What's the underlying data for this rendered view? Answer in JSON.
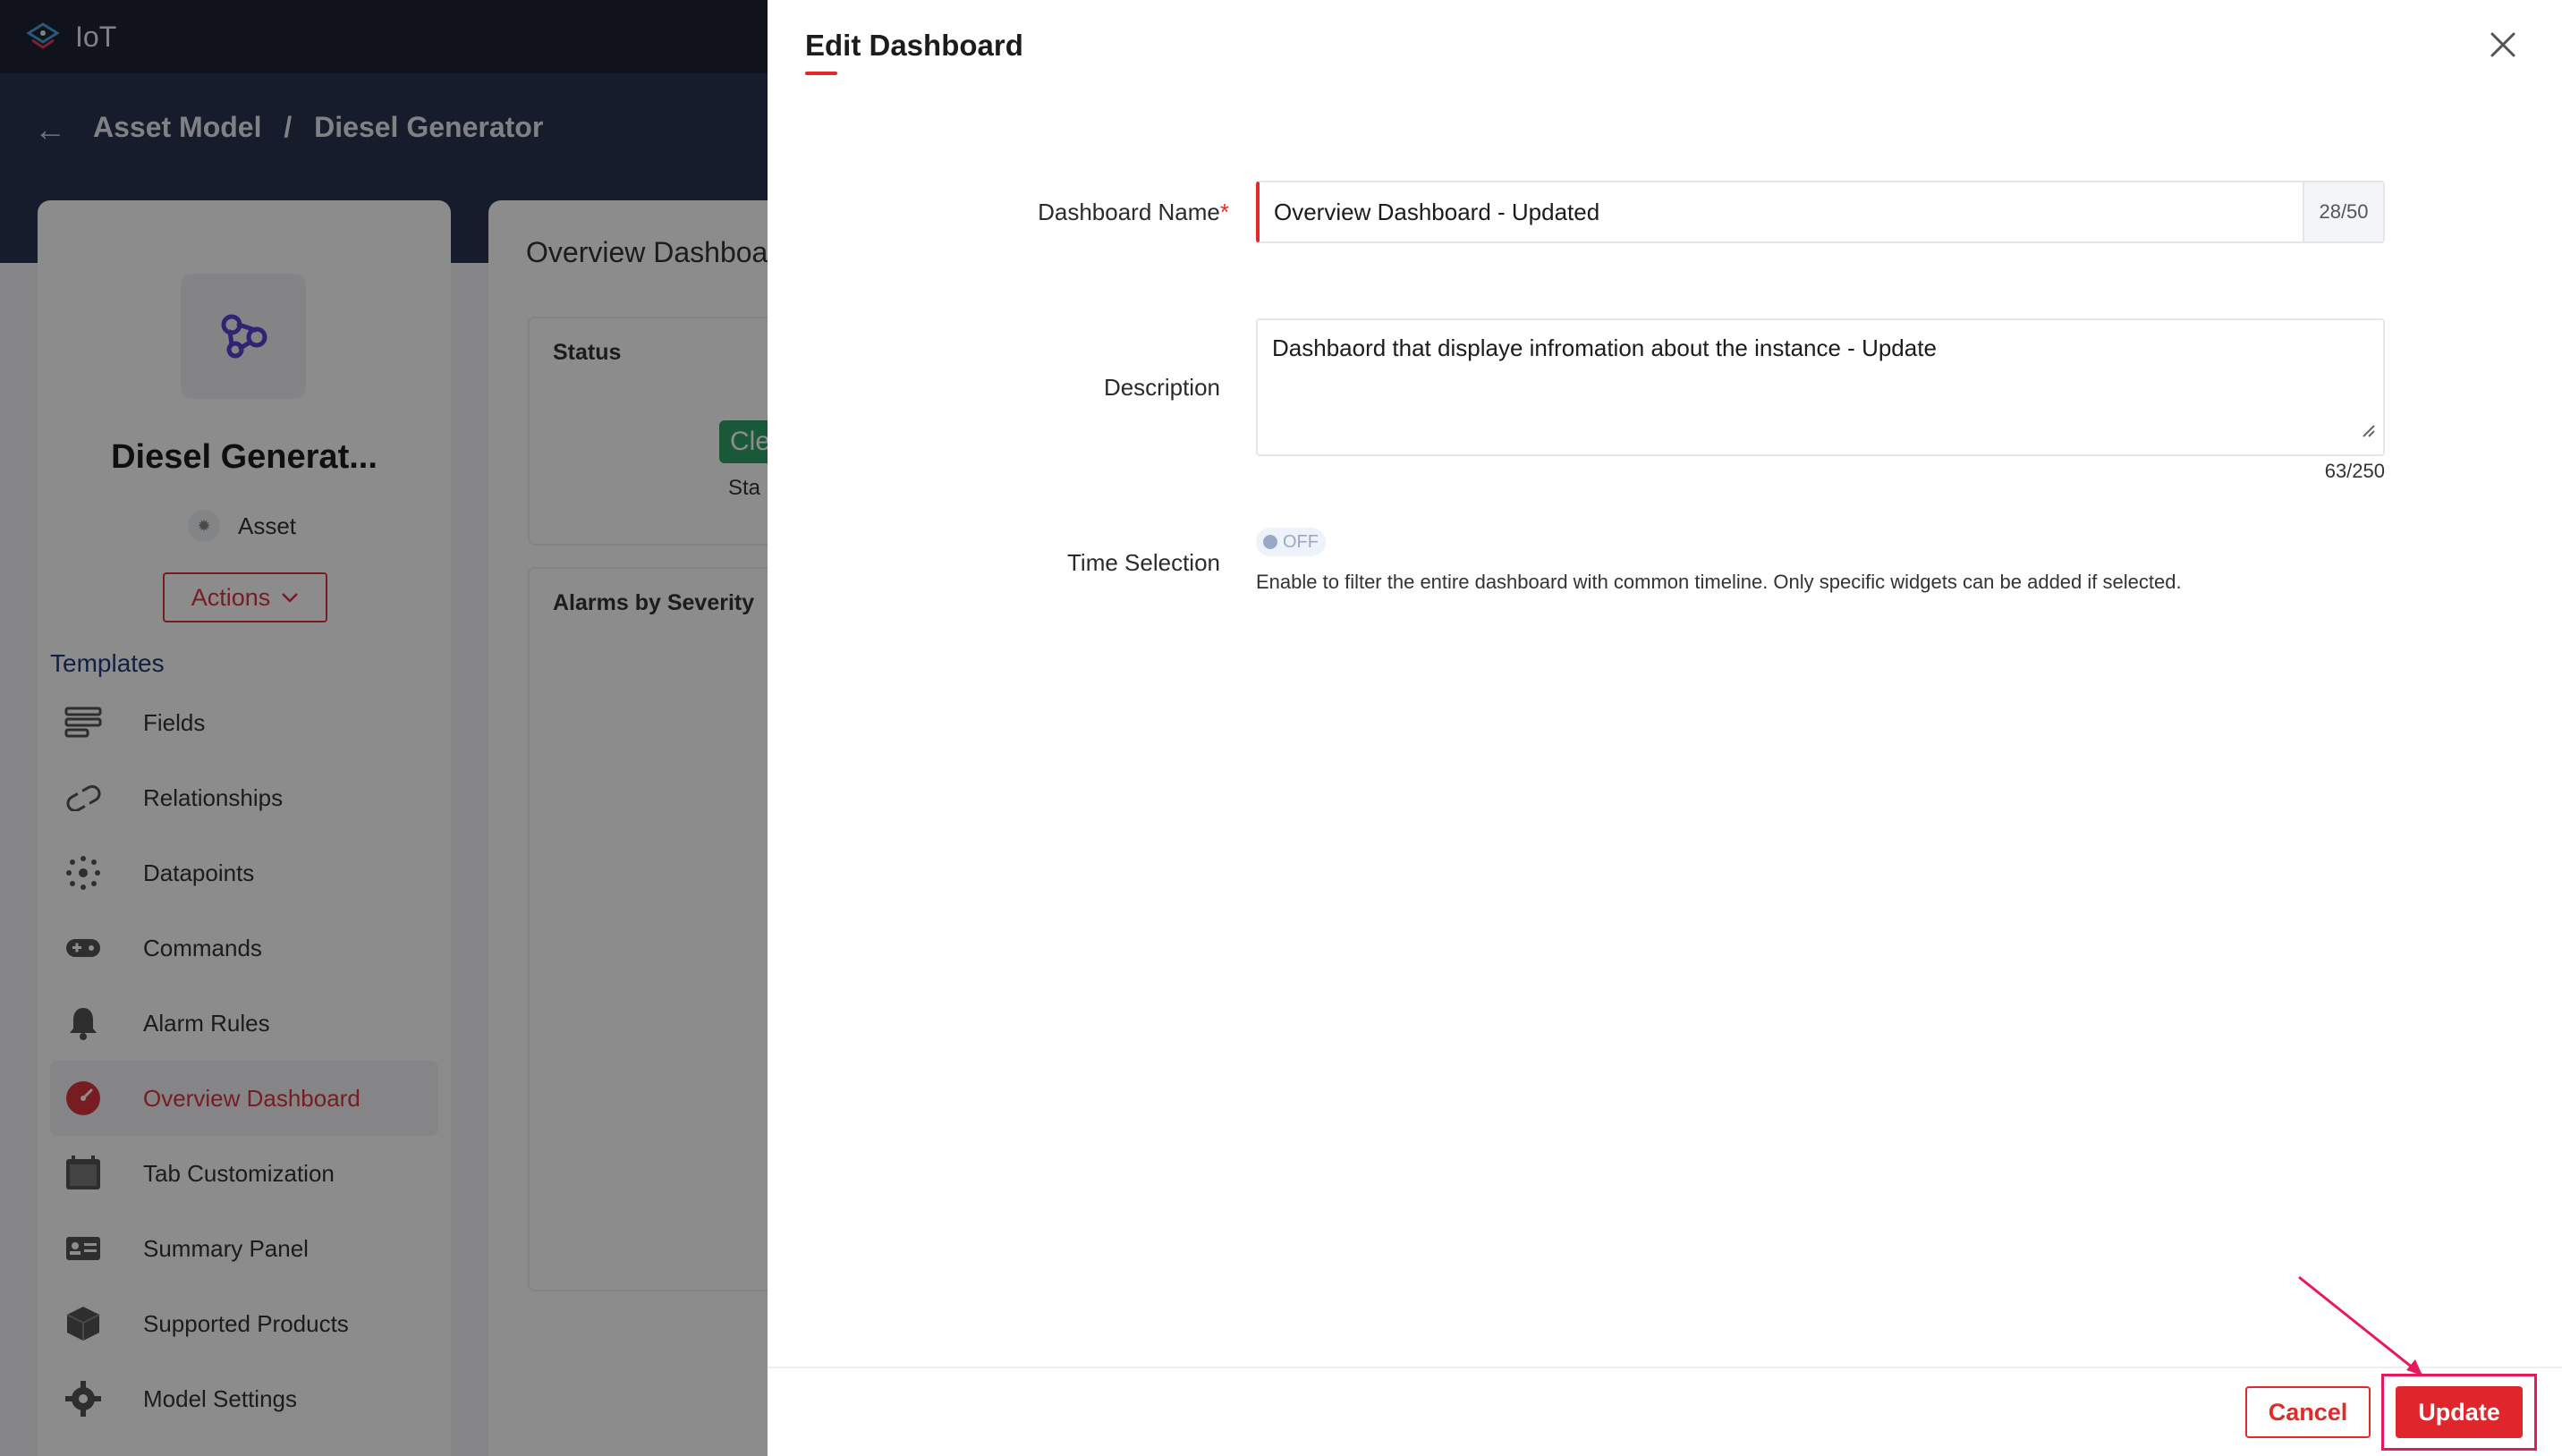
{
  "app": {
    "name": "IoT"
  },
  "breadcrumb": {
    "part1": "Asset Model",
    "separator": "/",
    "part2": "Diesel Generator"
  },
  "asset": {
    "name": "Diesel Generat...",
    "type": "Asset",
    "actions_label": "Actions"
  },
  "templates": {
    "heading": "Templates",
    "items": [
      {
        "label": "Fields",
        "icon": "fields-icon"
      },
      {
        "label": "Relationships",
        "icon": "link-icon"
      },
      {
        "label": "Datapoints",
        "icon": "datapoints-icon"
      },
      {
        "label": "Commands",
        "icon": "gamepad-icon"
      },
      {
        "label": "Alarm Rules",
        "icon": "bell-icon"
      },
      {
        "label": "Overview Dashboard",
        "icon": "gauge-icon",
        "active": true
      },
      {
        "label": "Tab Customization",
        "icon": "tab-icon"
      },
      {
        "label": "Summary Panel",
        "icon": "id-card-icon"
      },
      {
        "label": "Supported Products",
        "icon": "box-icon"
      },
      {
        "label": "Model Settings",
        "icon": "gear-icon"
      }
    ]
  },
  "dashboard_bg": {
    "title": "Overview Dashboa",
    "status_panel": {
      "title": "Status",
      "badge": "Cle",
      "sub": "Sta"
    },
    "alarm_panel": {
      "title": "Alarms by Severity"
    }
  },
  "modal": {
    "title": "Edit Dashboard",
    "name_label": "Dashboard Name",
    "name_required": "*",
    "name_value": "Overview Dashboard - Updated",
    "name_counter": "28/50",
    "description_label": "Description",
    "description_value": "Dashbaord that displaye infromation about the instance - Update",
    "description_counter": "63/250",
    "time_label": "Time Selection",
    "toggle_state": "OFF",
    "time_hint": "Enable to filter the entire dashboard with common timeline. Only specific widgets can be added if selected.",
    "cancel_label": "Cancel",
    "update_label": "Update"
  },
  "colors": {
    "accent": "#e22a2a",
    "header": "#1e2433",
    "hero": "#283350",
    "highlight": "#e8195a",
    "status_green": "#2fa36b"
  }
}
